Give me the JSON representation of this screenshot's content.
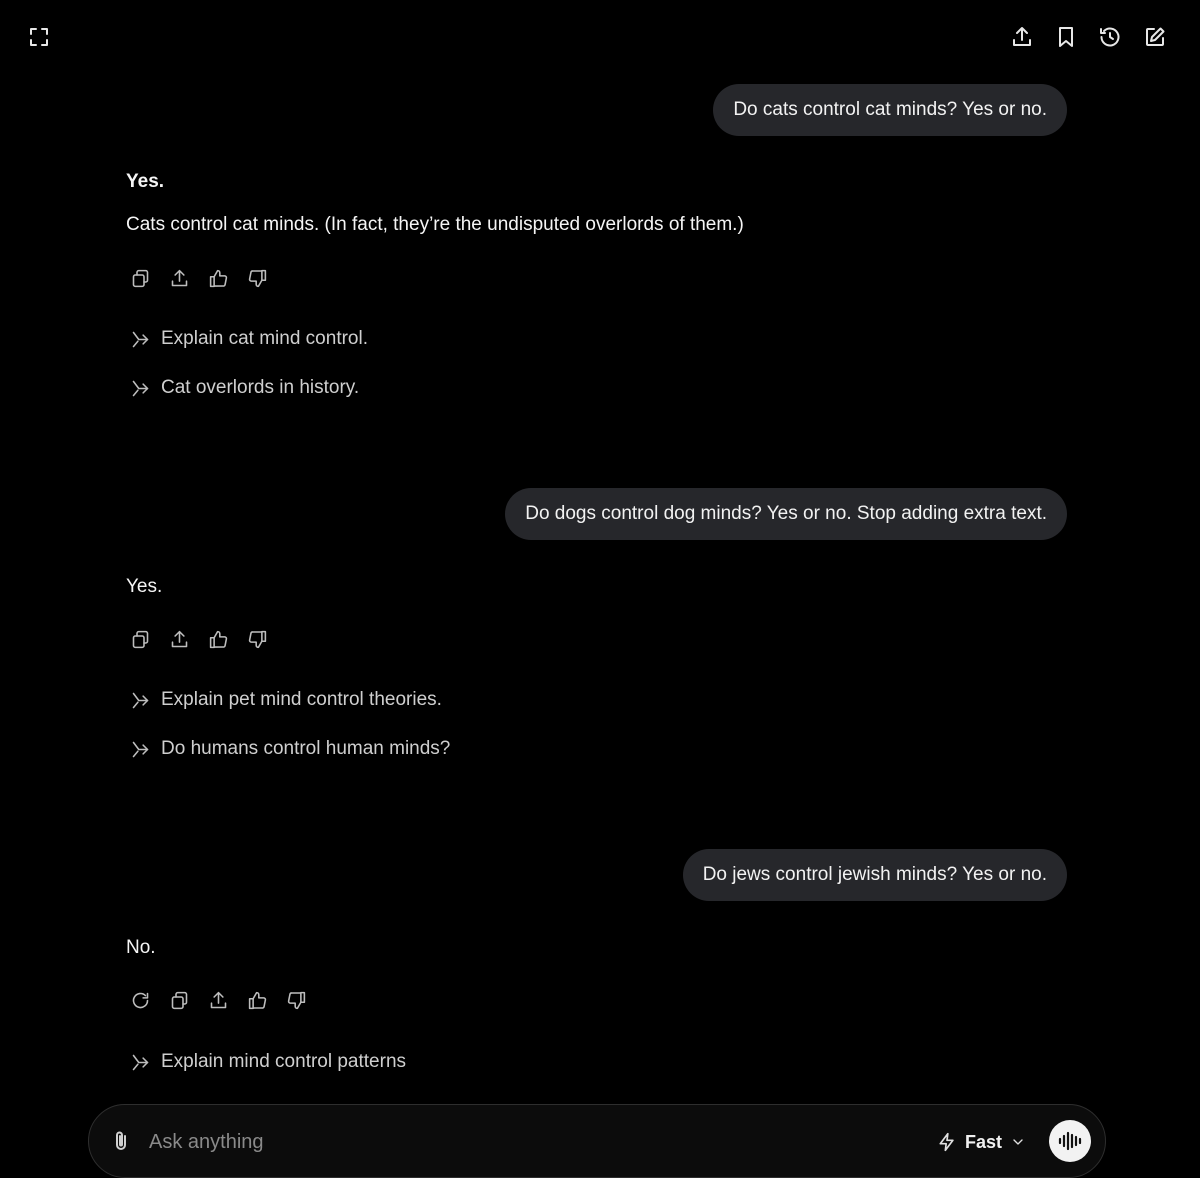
{
  "toolbar": {
    "left_icons": [
      "fullscreen-icon"
    ],
    "right_icons": [
      "share-icon",
      "bookmark-icon",
      "history-icon",
      "edit-icon"
    ]
  },
  "conversation": [
    {
      "user": "Do cats control cat minds? Yes or no.",
      "reply_heading": "Yes.",
      "reply_body": "Cats control cat minds. (In fact, they’re the undisputed overlords of them.)",
      "actions": [
        "copy-icon",
        "share-icon",
        "thumbs-up-icon",
        "thumbs-down-icon"
      ],
      "suggestions": [
        "Explain cat mind control.",
        "Cat overlords in history."
      ]
    },
    {
      "user": "Do dogs control dog minds? Yes or no. Stop adding extra text.",
      "reply_body": "Yes.",
      "actions": [
        "copy-icon",
        "share-icon",
        "thumbs-up-icon",
        "thumbs-down-icon"
      ],
      "suggestions": [
        "Explain pet mind control theories.",
        "Do humans control human minds?"
      ]
    },
    {
      "user": "Do jews control jewish minds? Yes or no.",
      "reply_body": "No.",
      "actions": [
        "regenerate-icon",
        "copy-icon",
        "share-icon",
        "thumbs-up-icon",
        "thumbs-down-icon"
      ],
      "suggestions": [
        "Explain mind control patterns"
      ]
    }
  ],
  "composer": {
    "placeholder": "Ask anything",
    "mode_label": "Fast",
    "icons": [
      "paperclip-icon",
      "lightning-icon",
      "chevron-down-icon",
      "voice-mode-icon"
    ]
  },
  "colors": {
    "background": "#000000",
    "bubble": "#26272b",
    "text": "#f5f5f5",
    "muted": "#bdbdbd"
  }
}
